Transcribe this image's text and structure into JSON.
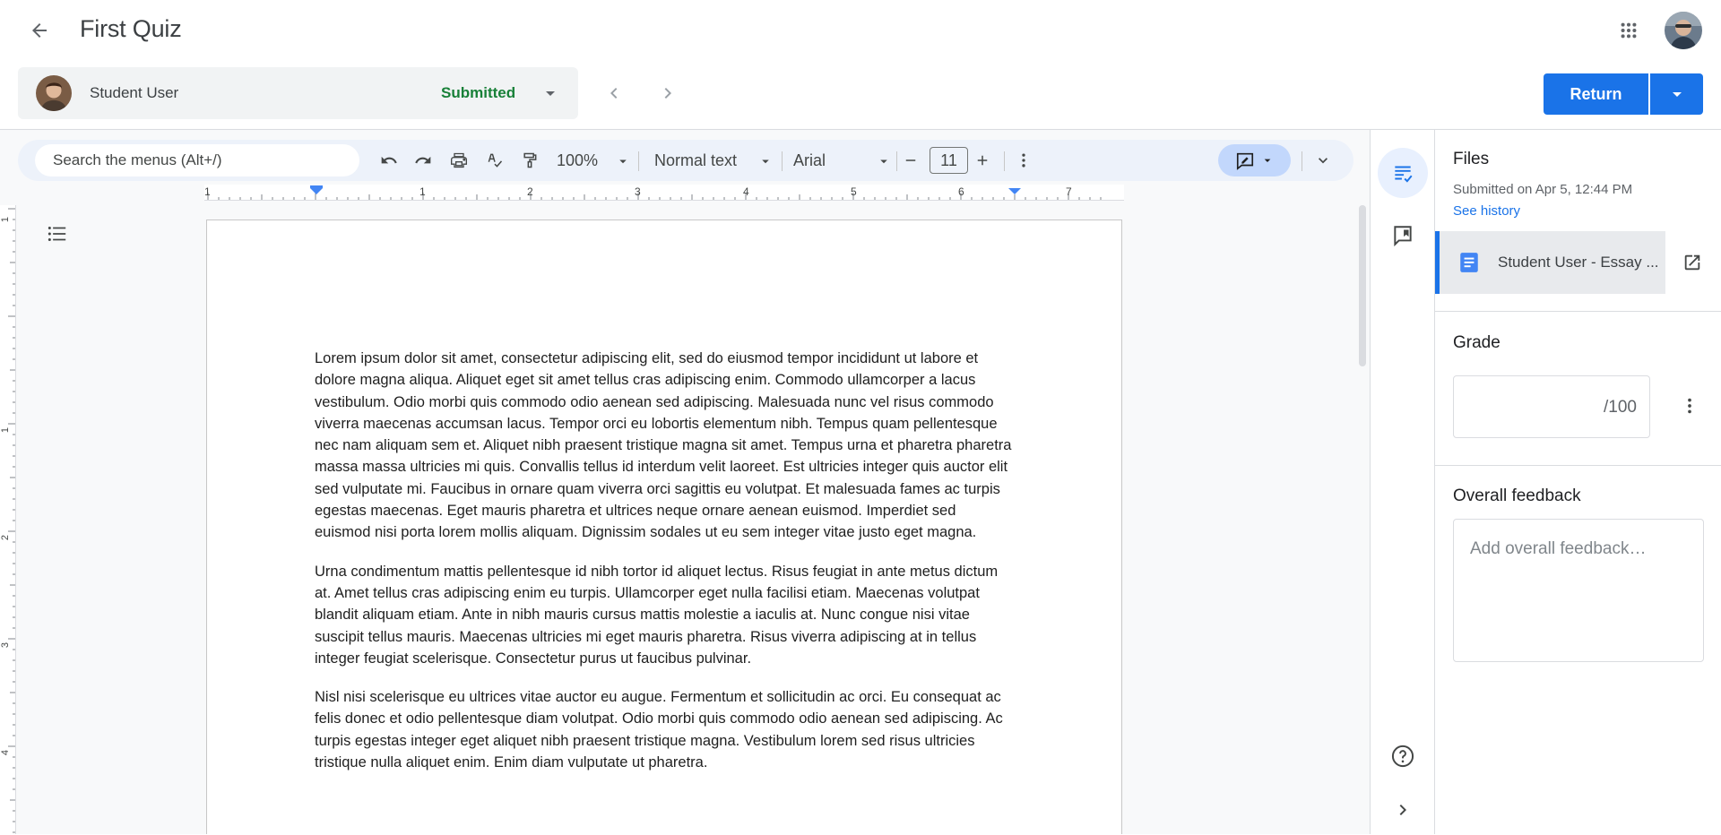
{
  "header": {
    "title": "First Quiz",
    "back_icon": "arrow-back-icon",
    "apps_icon": "google-apps-icon",
    "avatar_icon": "account-avatar"
  },
  "student_bar": {
    "name": "Student User",
    "status": "Submitted",
    "status_color": "#188038",
    "dropdown_icon": "arrow-drop-down-icon"
  },
  "navigation": {
    "prev_icon": "chevron-left-icon",
    "next_icon": "chevron-right-icon"
  },
  "return_button": {
    "label": "Return",
    "color": "#1a73e8"
  },
  "toolbar": {
    "menu_search_placeholder": "Search the menus (Alt+/)",
    "zoom": "100%",
    "style": "Normal text",
    "font": "Arial",
    "font_size": "11",
    "icons": [
      "undo-icon",
      "redo-icon",
      "print-icon",
      "spellcheck-icon",
      "paint-format-icon",
      "decrease-font-size-icon",
      "increase-font-size-icon",
      "more-vert-icon",
      "editing-mode-icon",
      "collapse-toolbar-icon"
    ]
  },
  "ruler": {
    "h_labels": [
      "1",
      "1",
      "2",
      "3",
      "4",
      "5",
      "6",
      "7"
    ],
    "v_labels": [
      "1",
      "1",
      "2",
      "3",
      "4"
    ]
  },
  "document": {
    "paragraphs": [
      "Lorem ipsum dolor sit amet, consectetur adipiscing elit, sed do eiusmod tempor incididunt ut labore et dolore magna aliqua. Aliquet eget sit amet tellus cras adipiscing enim. Commodo ullamcorper a lacus vestibulum. Odio morbi quis commodo odio aenean sed adipiscing. Malesuada nunc vel risus commodo viverra maecenas accumsan lacus. Tempor orci eu lobortis elementum nibh. Tempus quam pellentesque nec nam aliquam sem et. Aliquet nibh praesent tristique magna sit amet. Tempus urna et pharetra pharetra massa massa ultricies mi quis. Convallis tellus id interdum velit laoreet. Est ultricies integer quis auctor elit sed vulputate mi. Faucibus in ornare quam viverra orci sagittis eu volutpat. Et malesuada fames ac turpis egestas maecenas. Eget mauris pharetra et ultrices neque ornare aenean euismod. Imperdiet sed euismod nisi porta lorem mollis aliquam. Dignissim sodales ut eu sem integer vitae justo eget magna.",
      "Urna condimentum mattis pellentesque id nibh tortor id aliquet lectus. Risus feugiat in ante metus dictum at. Amet tellus cras adipiscing enim eu turpis. Ullamcorper eget nulla facilisi etiam. Maecenas volutpat blandit aliquam etiam. Ante in nibh mauris cursus mattis molestie a iaculis at. Nunc congue nisi vitae suscipit tellus mauris. Maecenas ultricies mi eget mauris pharetra. Risus viverra adipiscing at in tellus integer feugiat scelerisque. Consectetur purus ut faucibus pulvinar.",
      "Nisl nisi scelerisque eu ultrices vitae auctor eu augue. Fermentum et sollicitudin ac orci. Eu consequat ac felis donec et odio pellentesque diam volutpat. Odio morbi quis commodo odio aenean sed adipiscing. Ac turpis egestas integer eget aliquet nibh praesent tristique magna. Vestibulum lorem sed risus ultricies tristique nulla aliquet enim. Enim diam vulputate ut pharetra."
    ]
  },
  "side_rail": {
    "items": [
      "assignment-details-icon",
      "comment-bank-icon",
      "help-icon",
      "expand-panel-icon"
    ]
  },
  "right_panel": {
    "files_heading": "Files",
    "submitted_on": "Submitted on Apr 5, 12:44 PM",
    "see_history": "See history",
    "file_name": "Student User - Essay ...",
    "file_icon": "google-docs-icon",
    "open_icon": "open-in-new-icon",
    "grade_heading": "Grade",
    "grade_value": "",
    "grade_suffix": "/100",
    "grade_more_icon": "more-vert-icon",
    "feedback_heading": "Overall feedback",
    "feedback_placeholder": "Add overall feedback…"
  }
}
